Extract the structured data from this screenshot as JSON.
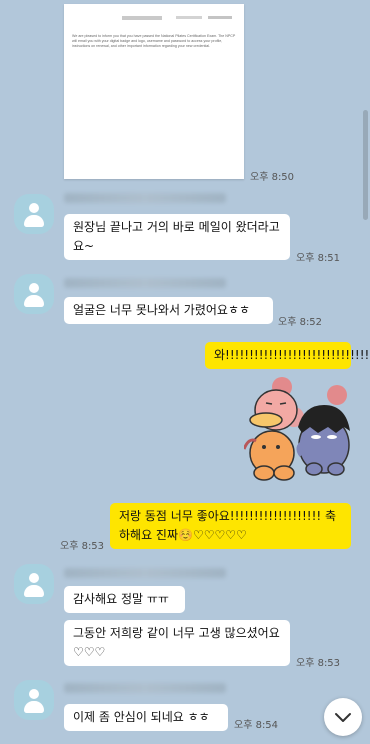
{
  "document_preview": {
    "body": "We are pleased to inform you that you have passed the National Pilates Certification Exam. The NPCP will email you with your digital badge and logo, username and password to access your profile, instructions on renewal, and other important information regarding your new credential.",
    "time": "오후 8:50"
  },
  "messages": [
    {
      "text": "원장님 끝나고 거의 바로 메일이 왔더라고요~",
      "time": "오후 8:51"
    },
    {
      "text": "얼굴은 너무 못나와서 가렸어요ㅎㅎ",
      "time": "오후 8:52"
    },
    {
      "text": "와!!!!!!!!!!!!!!!!!!!!!!!!!!!!!!"
    },
    {
      "text": "저랑 동점 너무 좋아요!!!!!!!!!!!!!!!!!!! 축하해요 진짜☺️♡♡♡♡♡",
      "time": "오후 8:53"
    },
    {
      "text": "감사해요 정말 ㅠㅠ"
    },
    {
      "text": "그동안 저희랑 같이 너무 고생 많으셨어요♡♡♡",
      "time": "오후 8:53"
    },
    {
      "text": "이제 좀 안심이 되네요 ㅎㅎ",
      "time": "오후 8:54"
    }
  ],
  "colors": {
    "background": "#b2c7da",
    "my_bubble": "#fee500",
    "their_bubble": "#ffffff",
    "avatar": "#a7d0df"
  },
  "icons": {
    "scroll_down": "chevron-down-icon",
    "avatar": "person-silhouette-icon"
  }
}
